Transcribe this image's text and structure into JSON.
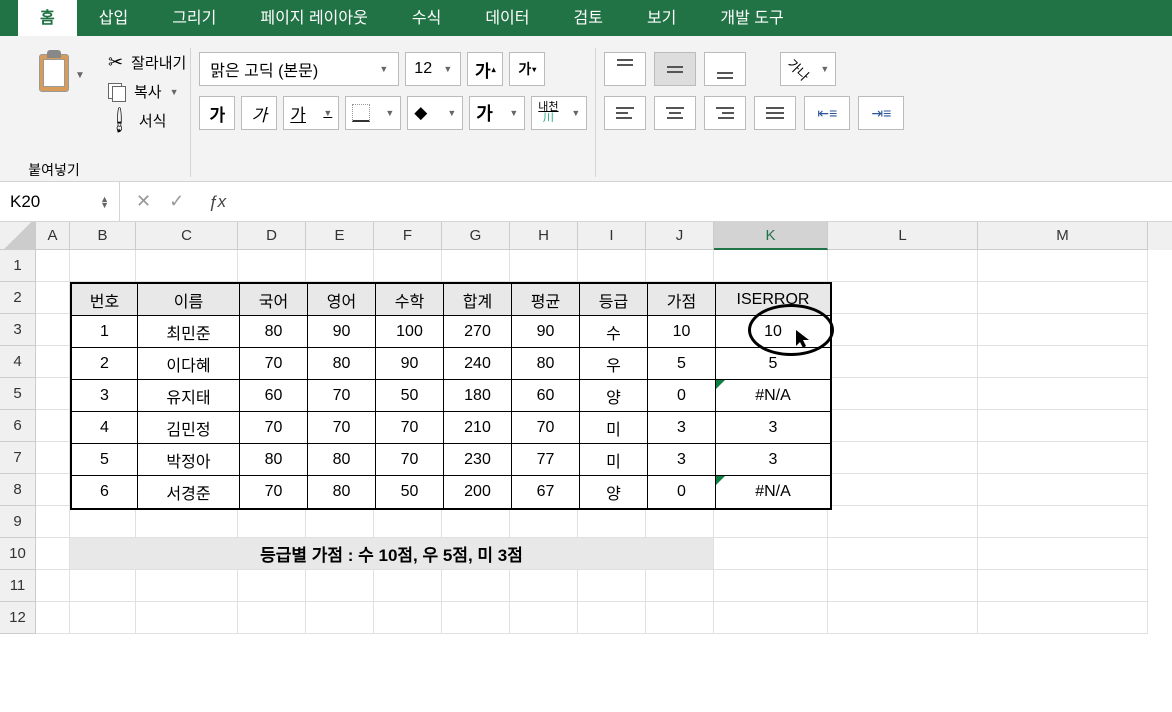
{
  "tabs": {
    "t0": "홈",
    "t1": "삽입",
    "t2": "그리기",
    "t3": "페이지 레이아웃",
    "t4": "수식",
    "t5": "데이터",
    "t6": "검토",
    "t7": "보기",
    "t8": "개발 도구"
  },
  "ribbon": {
    "paste": "붙여넣기",
    "cut": "잘라내기",
    "copy": "복사",
    "format": "서식",
    "font_name": "맑은 고딕 (본문)",
    "font_size": "12",
    "size_up": "가▴",
    "size_down": "가▾",
    "bold": "가",
    "italic": "가",
    "underline": "가",
    "font_color_glyph": "가",
    "fill_glyph": "◇",
    "wrap1": "내천",
    "wrap2": "川",
    "orient": "가나"
  },
  "formula": {
    "cell_ref": "K20",
    "fx": "ƒx",
    "formula_value": ""
  },
  "cols": {
    "A": "A",
    "B": "B",
    "C": "C",
    "D": "D",
    "E": "E",
    "F": "F",
    "G": "G",
    "H": "H",
    "I": "I",
    "J": "J",
    "K": "K",
    "L": "L",
    "M": "M"
  },
  "rows": {
    "1": "1",
    "2": "2",
    "3": "3",
    "4": "4",
    "5": "5",
    "6": "6",
    "7": "7",
    "8": "8",
    "9": "9",
    "10": "10",
    "11": "11",
    "12": "12"
  },
  "table": {
    "headers": {
      "h0": "번호",
      "h1": "이름",
      "h2": "국어",
      "h3": "영어",
      "h4": "수학",
      "h5": "합계",
      "h6": "평균",
      "h7": "등급",
      "h8": "가점",
      "h9": "ISERROR"
    },
    "r1": {
      "c0": "1",
      "c1": "최민준",
      "c2": "80",
      "c3": "90",
      "c4": "100",
      "c5": "270",
      "c6": "90",
      "c7": "수",
      "c8": "10",
      "c9": "10"
    },
    "r2": {
      "c0": "2",
      "c1": "이다혜",
      "c2": "70",
      "c3": "80",
      "c4": "90",
      "c5": "240",
      "c6": "80",
      "c7": "우",
      "c8": "5",
      "c9": "5"
    },
    "r3": {
      "c0": "3",
      "c1": "유지태",
      "c2": "60",
      "c3": "70",
      "c4": "50",
      "c5": "180",
      "c6": "60",
      "c7": "양",
      "c8": "0",
      "c9": "#N/A"
    },
    "r4": {
      "c0": "4",
      "c1": "김민정",
      "c2": "70",
      "c3": "70",
      "c4": "70",
      "c5": "210",
      "c6": "70",
      "c7": "미",
      "c8": "3",
      "c9": "3"
    },
    "r5": {
      "c0": "5",
      "c1": "박정아",
      "c2": "80",
      "c3": "80",
      "c4": "70",
      "c5": "230",
      "c6": "77",
      "c7": "미",
      "c8": "3",
      "c9": "3"
    },
    "r6": {
      "c0": "6",
      "c1": "서경준",
      "c2": "70",
      "c3": "80",
      "c4": "50",
      "c5": "200",
      "c6": "67",
      "c7": "양",
      "c8": "0",
      "c9": "#N/A"
    }
  },
  "note": "등급별 가점 : 수 10점, 우 5점, 미 3점",
  "chart_data": {
    "type": "table",
    "title": "",
    "columns": [
      "번호",
      "이름",
      "국어",
      "영어",
      "수학",
      "합계",
      "평균",
      "등급",
      "가점",
      "ISERROR"
    ],
    "rows": [
      [
        1,
        "최민준",
        80,
        90,
        100,
        270,
        90,
        "수",
        10,
        "10"
      ],
      [
        2,
        "이다혜",
        70,
        80,
        90,
        240,
        80,
        "우",
        5,
        "5"
      ],
      [
        3,
        "유지태",
        60,
        70,
        50,
        180,
        60,
        "양",
        0,
        "#N/A"
      ],
      [
        4,
        "김민정",
        70,
        70,
        70,
        210,
        70,
        "미",
        3,
        "3"
      ],
      [
        5,
        "박정아",
        80,
        80,
        70,
        230,
        77,
        "미",
        3,
        "3"
      ],
      [
        6,
        "서경준",
        70,
        80,
        50,
        200,
        67,
        "양",
        0,
        "#N/A"
      ]
    ],
    "note": "등급별 가점 : 수 10점, 우 5점, 미 3점"
  }
}
